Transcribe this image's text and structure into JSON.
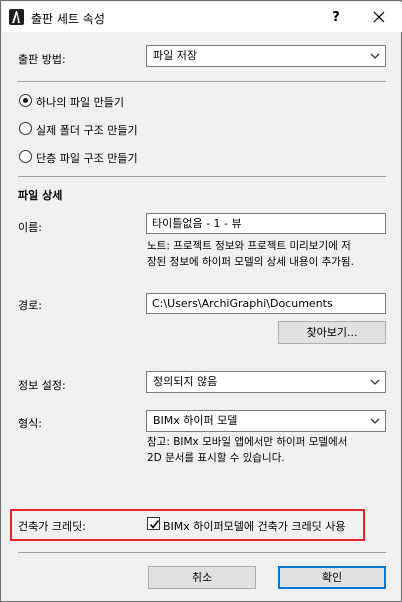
{
  "window": {
    "title": "출판 세트 속성",
    "help_label": "?",
    "close_label": "✕"
  },
  "publish_method": {
    "label": "출판 방법:",
    "value": "파일 저장"
  },
  "structure_options": [
    {
      "label": "하나의 파일 만들기",
      "checked": true
    },
    {
      "label": "실제 폴더 구조 만들기",
      "checked": false
    },
    {
      "label": "단층 파일 구조 만들기",
      "checked": false
    }
  ],
  "file_details": {
    "heading": "파일 상세",
    "name_label": "이름:",
    "name_value": "타이틀없음 - 1 - 뷰",
    "name_note_line1": "노트: 프로젝트 정보와 프로젝트 미리보기에 저",
    "name_note_line2": "장된 정보에 하이퍼 모델의 상세 내용이 추가됨.",
    "path_label": "경로:",
    "path_value": "C:\\Users\\ArchiGraphi\\Documents",
    "browse_label": "찾아보기..."
  },
  "info_settings": {
    "label": "정보 설정:",
    "value": "정의되지 않음"
  },
  "format": {
    "label": "형식:",
    "value": "BIMx 하이퍼 모델",
    "note_line1": "참고: BIMx 모바일 앱에서만 하이퍼 모델에서",
    "note_line2": "2D 문서를 표시할 수 있습니다."
  },
  "building_credits": {
    "label": "건축가 크레딧:",
    "checkbox_label": "BIMx 하이퍼모델에 건축가 크레딧 사용",
    "checked": true
  },
  "buttons": {
    "cancel": "취소",
    "ok": "확인"
  },
  "colors": {
    "highlight": "#e3242b",
    "default_button_border": "#0078d7"
  }
}
